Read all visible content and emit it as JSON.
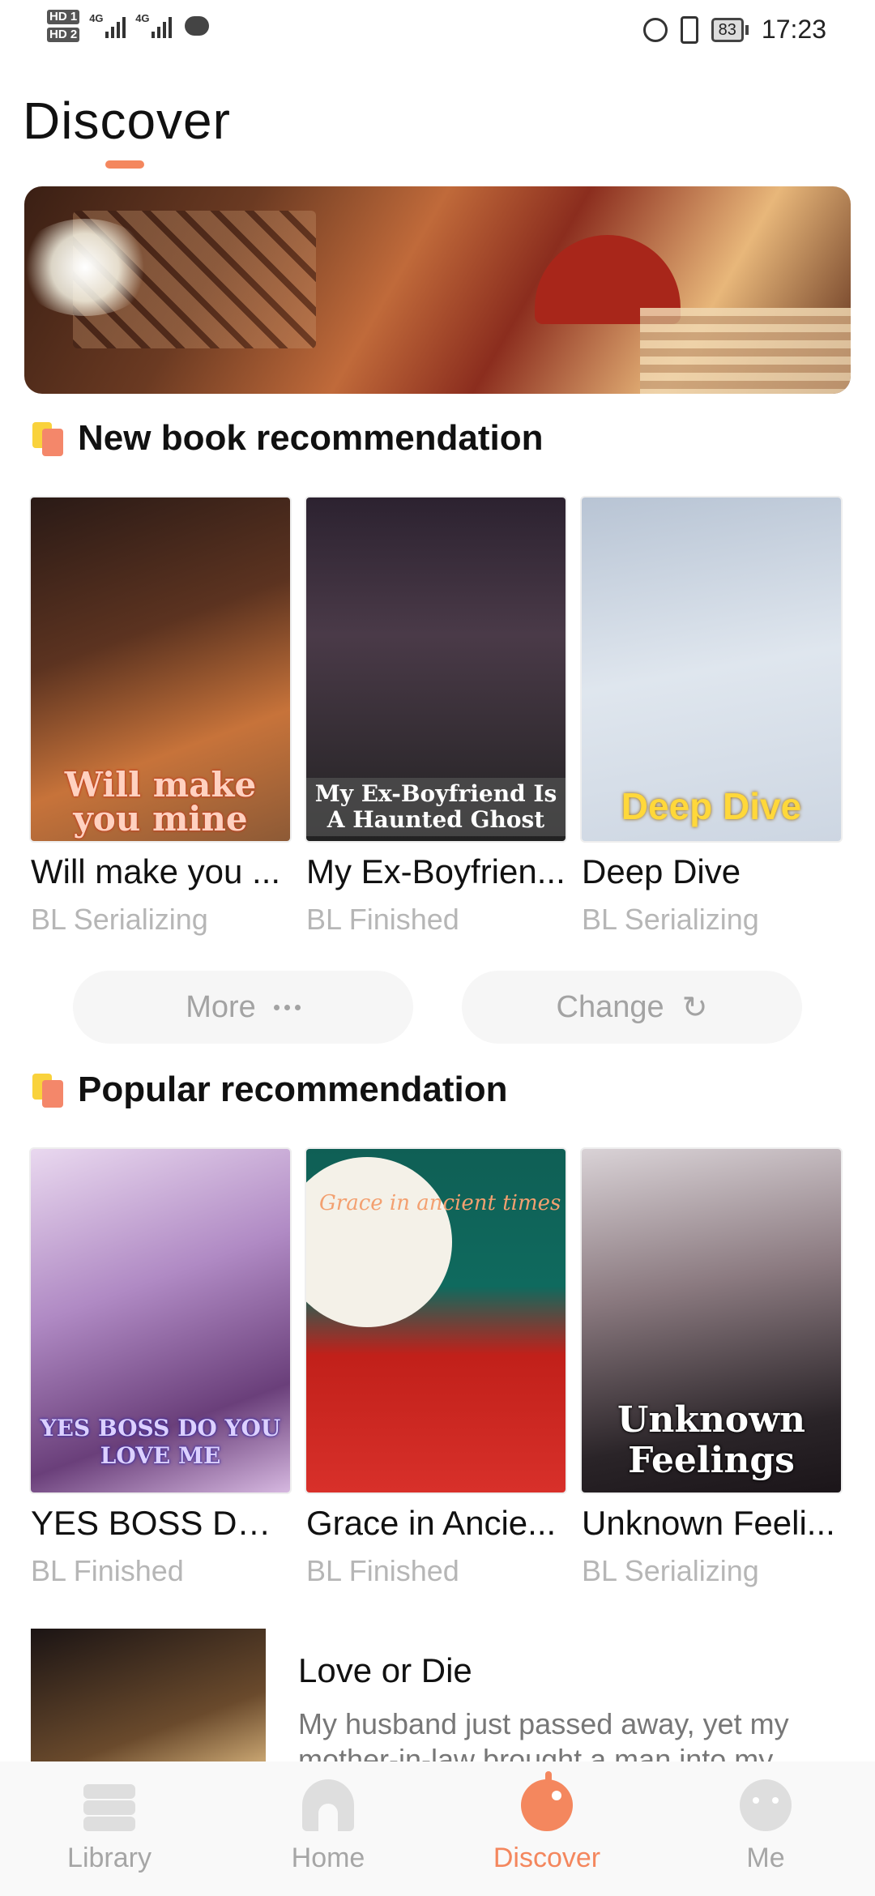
{
  "status_bar": {
    "hd_top": "HD 1",
    "hd_bottom": "HD 2",
    "net1": "4G",
    "net2": "4G",
    "battery": "83",
    "time": "17:23"
  },
  "header": {
    "title": "Discover"
  },
  "sections": [
    {
      "title": "New book recommendation",
      "books": [
        {
          "title": "Will make you ...",
          "meta": "BL Serializing",
          "cover_text": "Will make you mine"
        },
        {
          "title": "My Ex-Boyfrien...",
          "meta": "BL Finished",
          "cover_text": "My Ex-Boyfriend Is A Haunted Ghost"
        },
        {
          "title": "Deep Dive",
          "meta": "BL Serializing",
          "cover_text": "Deep Dive"
        }
      ]
    },
    {
      "title": "Popular recommendation",
      "books": [
        {
          "title": "YES BOSS DO ...",
          "meta": "BL Finished",
          "cover_text": "YES BOSS DO YOU LOVE ME"
        },
        {
          "title": "Grace in Ancie...",
          "meta": "BL Finished",
          "cover_text": "Grace in ancient times"
        },
        {
          "title": "Unknown Feeli...",
          "meta": "BL Serializing",
          "cover_text": "Unknown Feelings"
        }
      ]
    }
  ],
  "buttons": {
    "more": "More",
    "change": "Change"
  },
  "list_item": {
    "title": "Love or Die",
    "description": "My husband just passed away, yet my mother-in-law brought a man into my"
  },
  "bottom_nav": [
    {
      "label": "Library",
      "icon": "library-icon",
      "active": false
    },
    {
      "label": "Home",
      "icon": "home-icon",
      "active": false
    },
    {
      "label": "Discover",
      "icon": "discover-icon",
      "active": true
    },
    {
      "label": "Me",
      "icon": "me-icon",
      "active": false
    }
  ],
  "colors": {
    "accent": "#f4875e",
    "meta_gray": "#b6b6b6"
  }
}
